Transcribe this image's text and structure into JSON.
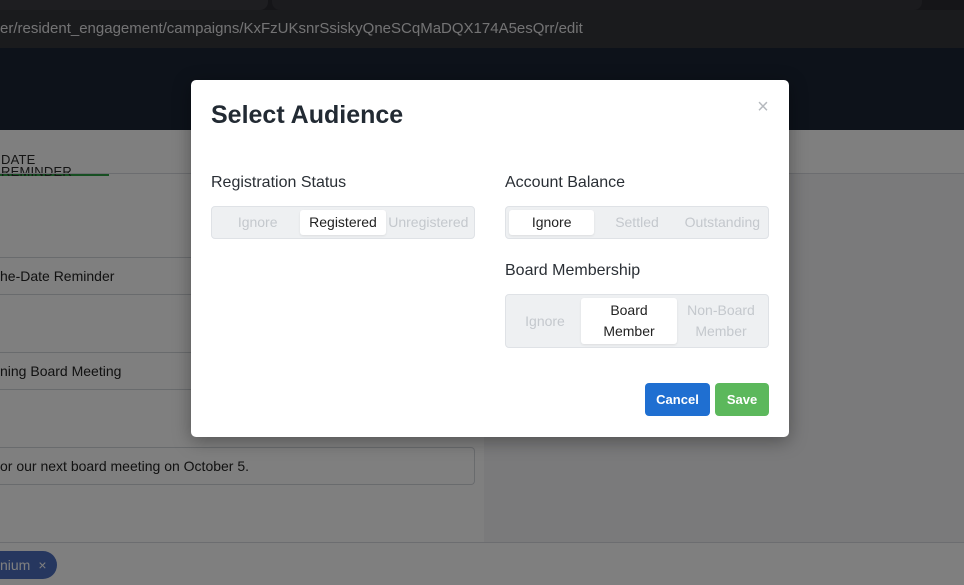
{
  "browser": {
    "url": "er/resident_engagement/campaigns/KxFzUKsnrSsiskyQneSCqMaDQX174A5esQrr/edit"
  },
  "background": {
    "tab_label": "DATE REMINDER",
    "field1_value": "he-Date Reminder",
    "field2_value": "ning Board Meeting",
    "field3_value": "or our next board meeting on October 5.",
    "chip_label": "nium",
    "chip_remove": "×"
  },
  "modal": {
    "title": "Select Audience",
    "close_symbol": "×",
    "registration": {
      "label": "Registration Status",
      "options": [
        "Ignore",
        "Registered",
        "Unregistered"
      ],
      "selected": "Registered"
    },
    "account_balance": {
      "label": "Account Balance",
      "options": [
        "Ignore",
        "Settled",
        "Outstanding"
      ],
      "selected": "Ignore"
    },
    "board_membership": {
      "label": "Board Membership",
      "options": [
        "Ignore",
        "Board Member",
        "Non-Board Member"
      ],
      "selected": "Board Member"
    },
    "cancel_label": "Cancel",
    "save_label": "Save"
  },
  "colors": {
    "header_bg": "#1b2535",
    "primary": "#1f6fd1",
    "success": "#5cb85c",
    "tab_accent": "#2f9e44"
  }
}
